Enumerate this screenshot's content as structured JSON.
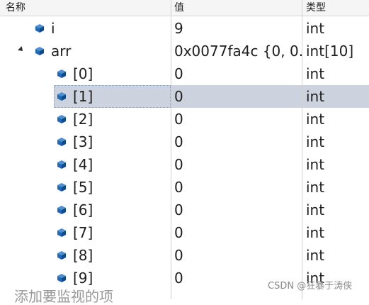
{
  "headers": {
    "name": "名称",
    "value": "值",
    "type": "类型"
  },
  "rows": [
    {
      "name": "i",
      "value": "9",
      "type": "int"
    },
    {
      "name": "arr",
      "value": "0x0077fa4c {0, 0...",
      "type": "int[10]"
    },
    {
      "name": "[0]",
      "value": "0",
      "type": "int"
    },
    {
      "name": "[1]",
      "value": "0",
      "type": "int"
    },
    {
      "name": "[2]",
      "value": "0",
      "type": "int"
    },
    {
      "name": "[3]",
      "value": "0",
      "type": "int"
    },
    {
      "name": "[4]",
      "value": "0",
      "type": "int"
    },
    {
      "name": "[5]",
      "value": "0",
      "type": "int"
    },
    {
      "name": "[6]",
      "value": "0",
      "type": "int"
    },
    {
      "name": "[7]",
      "value": "0",
      "type": "int"
    },
    {
      "name": "[8]",
      "value": "0",
      "type": "int"
    },
    {
      "name": "[9]",
      "value": "0",
      "type": "int"
    }
  ],
  "add_watch_placeholder": "添加要监视的项",
  "watermark": "CSDN @狂暴于涛侠",
  "colors": {
    "selection": "#cdd3de",
    "icon": "#1e6bb8"
  },
  "icon_name": "variable-cube-icon"
}
